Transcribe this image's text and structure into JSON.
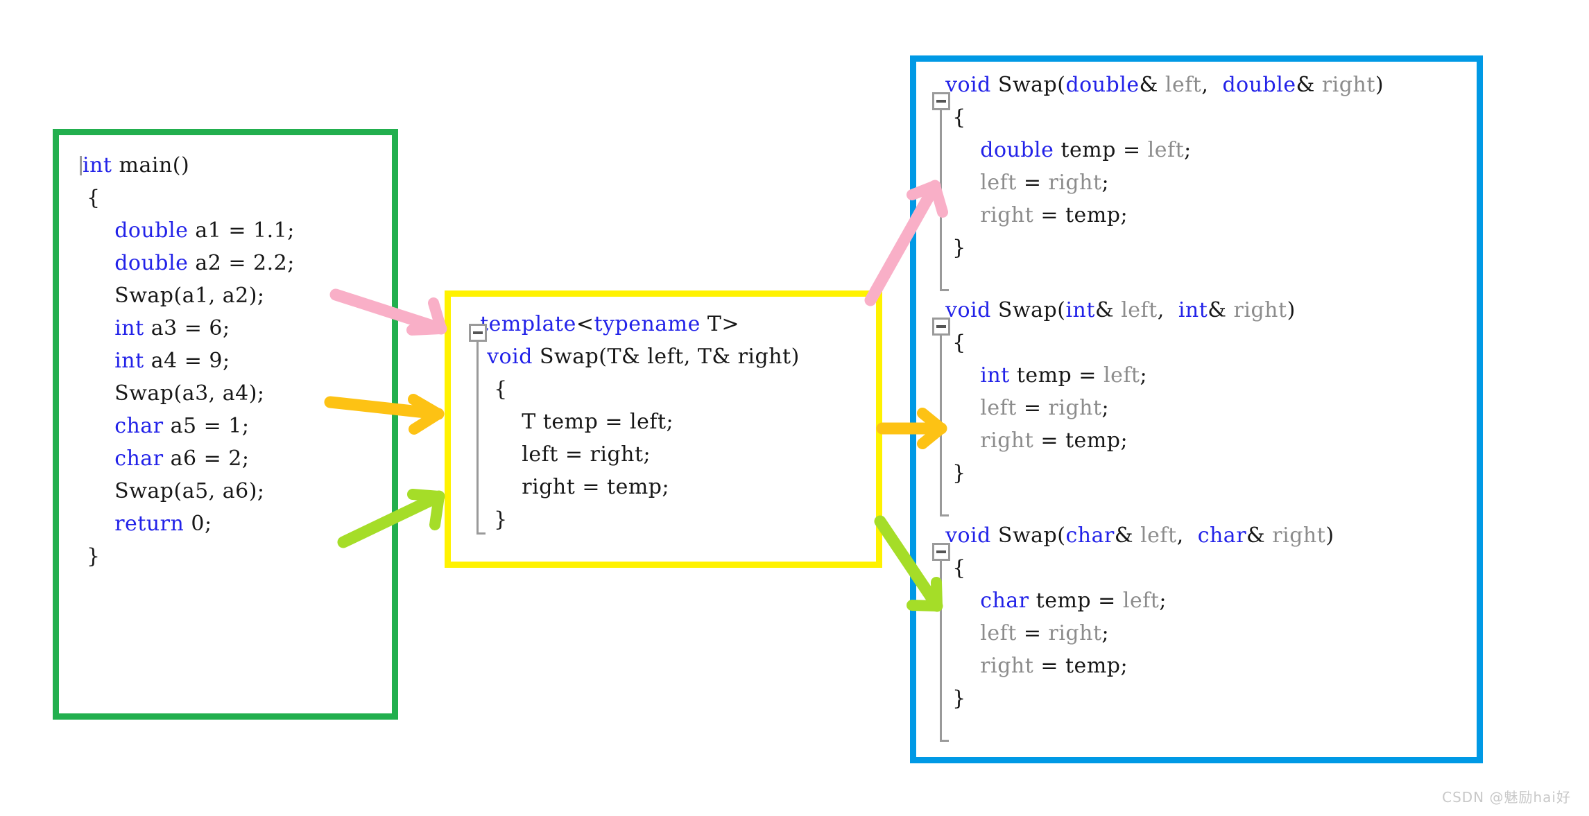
{
  "colors": {
    "main_border": "#22af4e",
    "template_border": "#fff200",
    "instantiations_border": "#0099e5",
    "keyword": "#2222e8",
    "identifier_gray": "#8c8c8c",
    "plain_text": "#171717",
    "arrow_pink": "#f9afc7",
    "arrow_orange": "#fdc214",
    "arrow_green": "#a5dd28",
    "fold_widget": "#9a9a9a",
    "watermark": "#c8c8c8"
  },
  "main_panel": {
    "title": "main-function-panel",
    "lines": [
      [
        {
          "t": "caret",
          "v": ""
        },
        {
          "t": "kw",
          "v": "int"
        },
        {
          "t": "plain",
          "v": " main()"
        }
      ],
      [
        {
          "t": "plain",
          "v": " {"
        }
      ],
      [
        {
          "t": "plain",
          "v": "     "
        },
        {
          "t": "kw",
          "v": "double"
        },
        {
          "t": "plain",
          "v": " a1 = 1.1;"
        }
      ],
      [
        {
          "t": "plain",
          "v": "     "
        },
        {
          "t": "kw",
          "v": "double"
        },
        {
          "t": "plain",
          "v": " a2 = 2.2;"
        }
      ],
      [
        {
          "t": "plain",
          "v": "     Swap(a1, a2);"
        }
      ],
      [
        {
          "t": "plain",
          "v": ""
        }
      ],
      [
        {
          "t": "plain",
          "v": "     "
        },
        {
          "t": "kw",
          "v": "int"
        },
        {
          "t": "plain",
          "v": " a3 = 6;"
        }
      ],
      [
        {
          "t": "plain",
          "v": "     "
        },
        {
          "t": "kw",
          "v": "int"
        },
        {
          "t": "plain",
          "v": " a4 = 9;"
        }
      ],
      [
        {
          "t": "plain",
          "v": "     Swap(a3, a4);"
        }
      ],
      [
        {
          "t": "plain",
          "v": ""
        }
      ],
      [
        {
          "t": "plain",
          "v": "     "
        },
        {
          "t": "kw",
          "v": "char"
        },
        {
          "t": "plain",
          "v": " a5 = 1;"
        }
      ],
      [
        {
          "t": "plain",
          "v": "     "
        },
        {
          "t": "kw",
          "v": "char"
        },
        {
          "t": "plain",
          "v": " a6 = 2;"
        }
      ],
      [
        {
          "t": "plain",
          "v": "     Swap(a5, a6);"
        }
      ],
      [
        {
          "t": "plain",
          "v": ""
        }
      ],
      [
        {
          "t": "plain",
          "v": "     "
        },
        {
          "t": "kw",
          "v": "return"
        },
        {
          "t": "plain",
          "v": " 0;"
        }
      ],
      [
        {
          "t": "plain",
          "v": " }"
        }
      ]
    ]
  },
  "template_panel": {
    "title": "function-template-panel",
    "fold_widget_label": "collapse",
    "lines": [
      [
        {
          "t": "pad",
          "v": "  "
        },
        {
          "t": "kw",
          "v": "template"
        },
        {
          "t": "plain",
          "v": "<"
        },
        {
          "t": "kw",
          "v": "typename"
        },
        {
          "t": "plain",
          "v": " T>"
        }
      ],
      [
        {
          "t": "pad",
          "v": "   "
        },
        {
          "t": "kw",
          "v": "void"
        },
        {
          "t": "plain",
          "v": " Swap(T& left, T& right)"
        }
      ],
      [
        {
          "t": "plain",
          "v": "    {"
        }
      ],
      [
        {
          "t": "plain",
          "v": "        T temp = left;"
        }
      ],
      [
        {
          "t": "plain",
          "v": "        left = right;"
        }
      ],
      [
        {
          "t": "plain",
          "v": "        right = temp;"
        }
      ],
      [
        {
          "t": "plain",
          "v": "    }"
        }
      ]
    ]
  },
  "instantiations_panel": {
    "title": "instantiated-functions-panel",
    "functions": [
      {
        "name": "swap-double",
        "type": "double",
        "lines": [
          [
            {
              "t": "pad",
              "v": "  "
            },
            {
              "t": "kw",
              "v": "void"
            },
            {
              "t": "plain",
              "v": " Swap("
            },
            {
              "t": "kw",
              "v": "double"
            },
            {
              "t": "plain",
              "v": "& "
            },
            {
              "t": "ident",
              "v": "left"
            },
            {
              "t": "plain",
              "v": ",  "
            },
            {
              "t": "kw",
              "v": "double"
            },
            {
              "t": "plain",
              "v": "& "
            },
            {
              "t": "ident",
              "v": "right"
            },
            {
              "t": "plain",
              "v": ")"
            }
          ],
          [
            {
              "t": "plain",
              "v": "   {"
            }
          ],
          [
            {
              "t": "plain",
              "v": "       "
            },
            {
              "t": "kw",
              "v": "double"
            },
            {
              "t": "plain",
              "v": " temp = "
            },
            {
              "t": "ident",
              "v": "left"
            },
            {
              "t": "plain",
              "v": ";"
            }
          ],
          [
            {
              "t": "plain",
              "v": "       "
            },
            {
              "t": "ident",
              "v": "left"
            },
            {
              "t": "plain",
              "v": " = "
            },
            {
              "t": "ident",
              "v": "right"
            },
            {
              "t": "plain",
              "v": ";"
            }
          ],
          [
            {
              "t": "plain",
              "v": "       "
            },
            {
              "t": "ident",
              "v": "right"
            },
            {
              "t": "plain",
              "v": " = temp;"
            }
          ],
          [
            {
              "t": "plain",
              "v": "   }"
            }
          ]
        ]
      },
      {
        "name": "swap-int",
        "type": "int",
        "lines": [
          [
            {
              "t": "pad",
              "v": "  "
            },
            {
              "t": "kw",
              "v": "void"
            },
            {
              "t": "plain",
              "v": " Swap("
            },
            {
              "t": "kw",
              "v": "int"
            },
            {
              "t": "plain",
              "v": "& "
            },
            {
              "t": "ident",
              "v": "left"
            },
            {
              "t": "plain",
              "v": ",  "
            },
            {
              "t": "kw",
              "v": "int"
            },
            {
              "t": "plain",
              "v": "& "
            },
            {
              "t": "ident",
              "v": "right"
            },
            {
              "t": "plain",
              "v": ")"
            }
          ],
          [
            {
              "t": "plain",
              "v": "   {"
            }
          ],
          [
            {
              "t": "plain",
              "v": "       "
            },
            {
              "t": "kw",
              "v": "int"
            },
            {
              "t": "plain",
              "v": " temp = "
            },
            {
              "t": "ident",
              "v": "left"
            },
            {
              "t": "plain",
              "v": ";"
            }
          ],
          [
            {
              "t": "plain",
              "v": "       "
            },
            {
              "t": "ident",
              "v": "left"
            },
            {
              "t": "plain",
              "v": " = "
            },
            {
              "t": "ident",
              "v": "right"
            },
            {
              "t": "plain",
              "v": ";"
            }
          ],
          [
            {
              "t": "plain",
              "v": "       "
            },
            {
              "t": "ident",
              "v": "right"
            },
            {
              "t": "plain",
              "v": " = temp;"
            }
          ],
          [
            {
              "t": "plain",
              "v": "   }"
            }
          ]
        ]
      },
      {
        "name": "swap-char",
        "type": "char",
        "lines": [
          [
            {
              "t": "pad",
              "v": "  "
            },
            {
              "t": "kw",
              "v": "void"
            },
            {
              "t": "plain",
              "v": " Swap("
            },
            {
              "t": "kw",
              "v": "char"
            },
            {
              "t": "plain",
              "v": "& "
            },
            {
              "t": "ident",
              "v": "left"
            },
            {
              "t": "plain",
              "v": ",  "
            },
            {
              "t": "kw",
              "v": "char"
            },
            {
              "t": "plain",
              "v": "& "
            },
            {
              "t": "ident",
              "v": "right"
            },
            {
              "t": "plain",
              "v": ")"
            }
          ],
          [
            {
              "t": "plain",
              "v": "   {"
            }
          ],
          [
            {
              "t": "plain",
              "v": "       "
            },
            {
              "t": "kw",
              "v": "char"
            },
            {
              "t": "plain",
              "v": " temp = "
            },
            {
              "t": "ident",
              "v": "left"
            },
            {
              "t": "plain",
              "v": ";"
            }
          ],
          [
            {
              "t": "plain",
              "v": "       "
            },
            {
              "t": "ident",
              "v": "left"
            },
            {
              "t": "plain",
              "v": " = "
            },
            {
              "t": "ident",
              "v": "right"
            },
            {
              "t": "plain",
              "v": ";"
            }
          ],
          [
            {
              "t": "plain",
              "v": "       "
            },
            {
              "t": "ident",
              "v": "right"
            },
            {
              "t": "plain",
              "v": " = temp;"
            }
          ],
          [
            {
              "t": "plain",
              "v": "   }"
            }
          ]
        ]
      }
    ]
  },
  "arrows": [
    {
      "name": "arrow-call-double-to-template",
      "color": "#f9afc7",
      "from": "Swap(a1, a2)",
      "to": "template"
    },
    {
      "name": "arrow-call-int-to-template",
      "color": "#fdc214",
      "from": "Swap(a3, a4)",
      "to": "template"
    },
    {
      "name": "arrow-call-char-to-template",
      "color": "#a5dd28",
      "from": "Swap(a5, a6)",
      "to": "template"
    },
    {
      "name": "arrow-template-to-swap-double",
      "color": "#f9afc7",
      "from": "template",
      "to": "swap-double"
    },
    {
      "name": "arrow-template-to-swap-int",
      "color": "#fdc214",
      "from": "template",
      "to": "swap-int"
    },
    {
      "name": "arrow-template-to-swap-char",
      "color": "#a5dd28",
      "from": "template",
      "to": "swap-char"
    }
  ],
  "watermark": {
    "text": "CSDN @魅励hai好"
  }
}
